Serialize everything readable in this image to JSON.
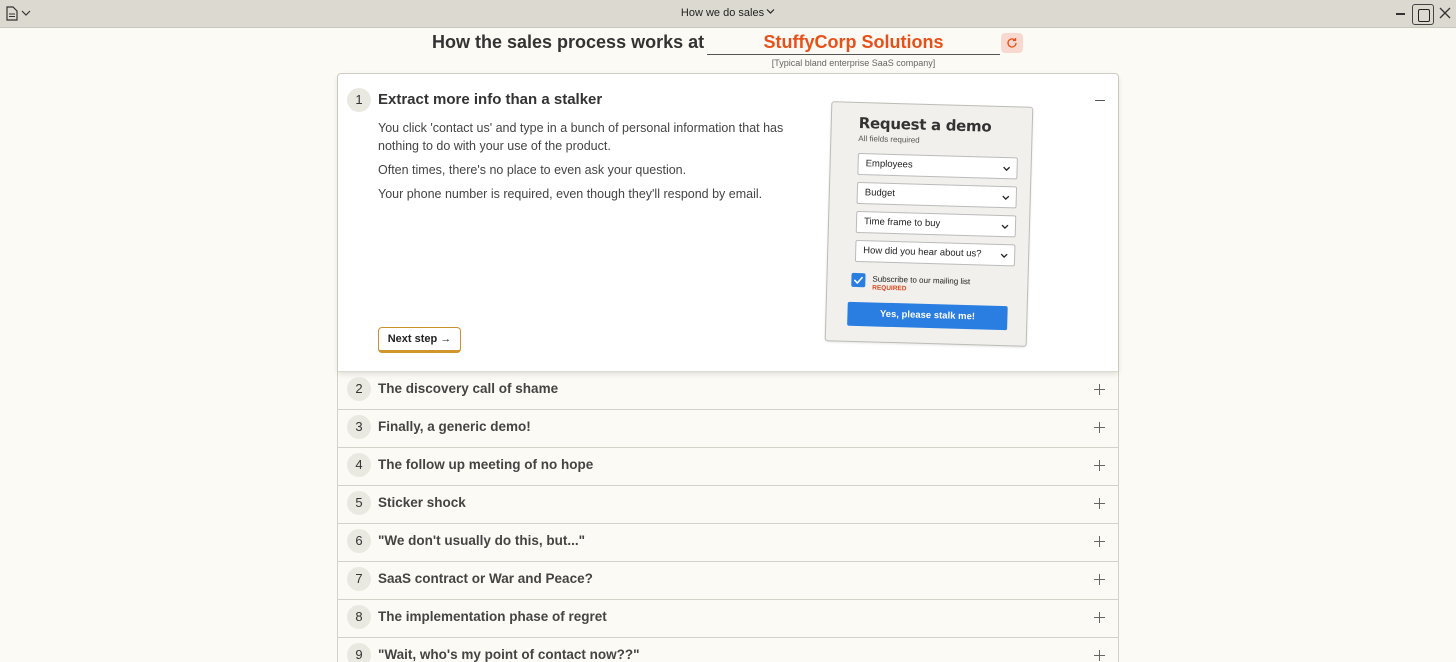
{
  "window": {
    "title": "How we do sales",
    "icons": [
      "document-icon",
      "chevron-down-icon",
      "minimize-icon",
      "maximize-icon",
      "close-icon"
    ]
  },
  "header": {
    "prefix": "How the sales process works at",
    "company": "StuffyCorp Solutions",
    "subtitle": "[Typical bland enterprise SaaS company]",
    "accent_color": "#e8501a"
  },
  "step1": {
    "number": "1",
    "title": "Extract more info than a stalker",
    "paragraphs": [
      "You click 'contact us' and type in a bunch of personal information that has nothing to do with your use of the product.",
      "Often times, there's no place to even ask your question.",
      "Your phone number is required, even though they'll respond by email."
    ],
    "next_label": "Next step →"
  },
  "demo_card": {
    "title": "Request a demo",
    "subtitle": "All fields required",
    "dropdowns": [
      "Employees",
      "Budget",
      "Time frame to buy",
      "How did you hear about us?"
    ],
    "checkbox_label": "Subscribe to our mailing list",
    "checkbox_checked": true,
    "required_label": "REQUIRED",
    "button_label": "Yes, please stalk me!",
    "button_color": "#2a7de1"
  },
  "steps": [
    {
      "number": "2",
      "title": "The discovery call of shame"
    },
    {
      "number": "3",
      "title": "Finally, a generic demo!"
    },
    {
      "number": "4",
      "title": "The follow up meeting of no hope"
    },
    {
      "number": "5",
      "title": "Sticker shock"
    },
    {
      "number": "6",
      "title": "\"We don't usually do this, but...\""
    },
    {
      "number": "7",
      "title": "SaaS contract or War and Peace?"
    },
    {
      "number": "8",
      "title": "The implementation phase of regret"
    },
    {
      "number": "9",
      "title": "\"Wait, who's my point of contact now??\""
    }
  ]
}
